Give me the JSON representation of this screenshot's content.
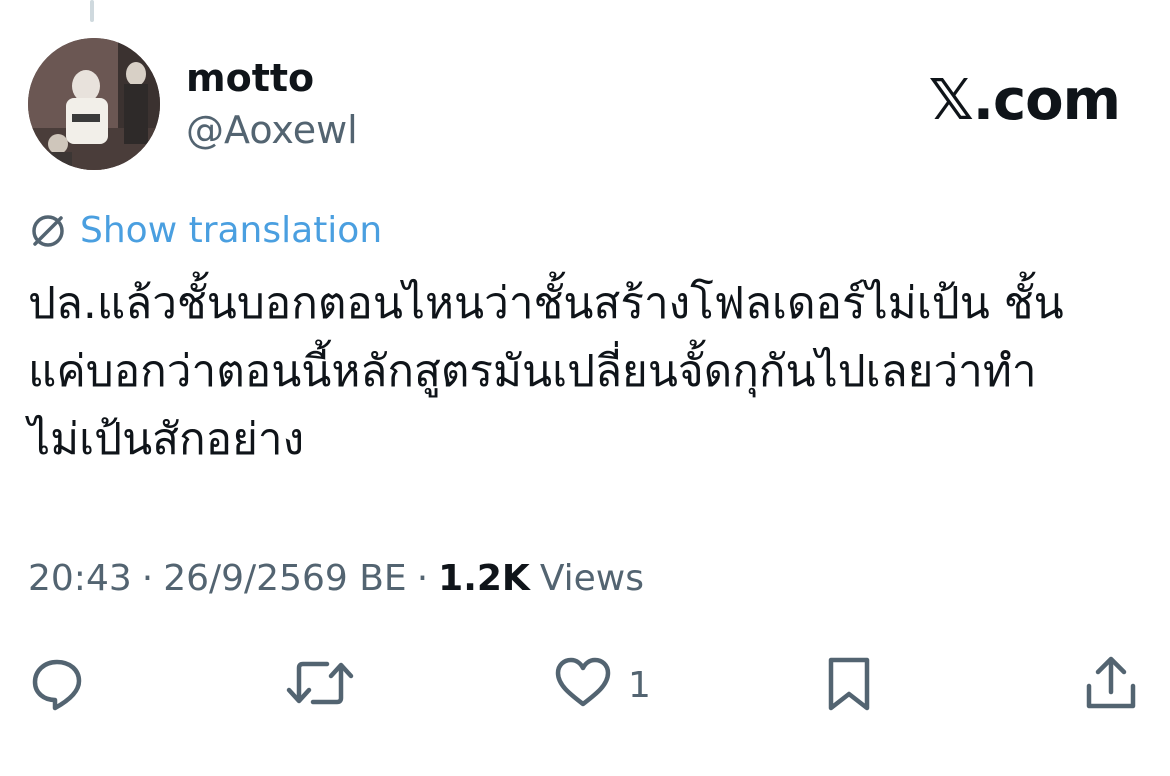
{
  "tweet": {
    "author": {
      "display_name": "motto",
      "handle": "@Aoxewl",
      "avatar": "avatar-photo"
    },
    "watermark": "𝕏.com",
    "translation_link": "Show translation",
    "text": "ปล.แล้วชั้นบอกตอนไหนว่าชั้นสร้างโฟลเดอร์ไม่เป้น ชั้น\nแค่บอกว่าตอนนี้หลักสูตรมันเปลี่ยนจั้ดกุกันไปเลยว่าทำ\nไม่เป้นสักอย่าง",
    "time": "20:43",
    "separator": "·",
    "date": "26/9/2569 BE",
    "views_count": "1.2K",
    "views_label": "Views"
  },
  "actions": {
    "reply": {
      "icon": "reply-icon",
      "count": ""
    },
    "retweet": {
      "icon": "retweet-icon",
      "count": ""
    },
    "like": {
      "icon": "heart-icon",
      "count": "1"
    },
    "bookmark": {
      "icon": "bookmark-icon",
      "count": ""
    },
    "share": {
      "icon": "share-icon",
      "count": ""
    }
  },
  "colors": {
    "text": "#0f1419",
    "secondary": "#536471",
    "link": "#4a9fe0",
    "icon": "#536471"
  }
}
